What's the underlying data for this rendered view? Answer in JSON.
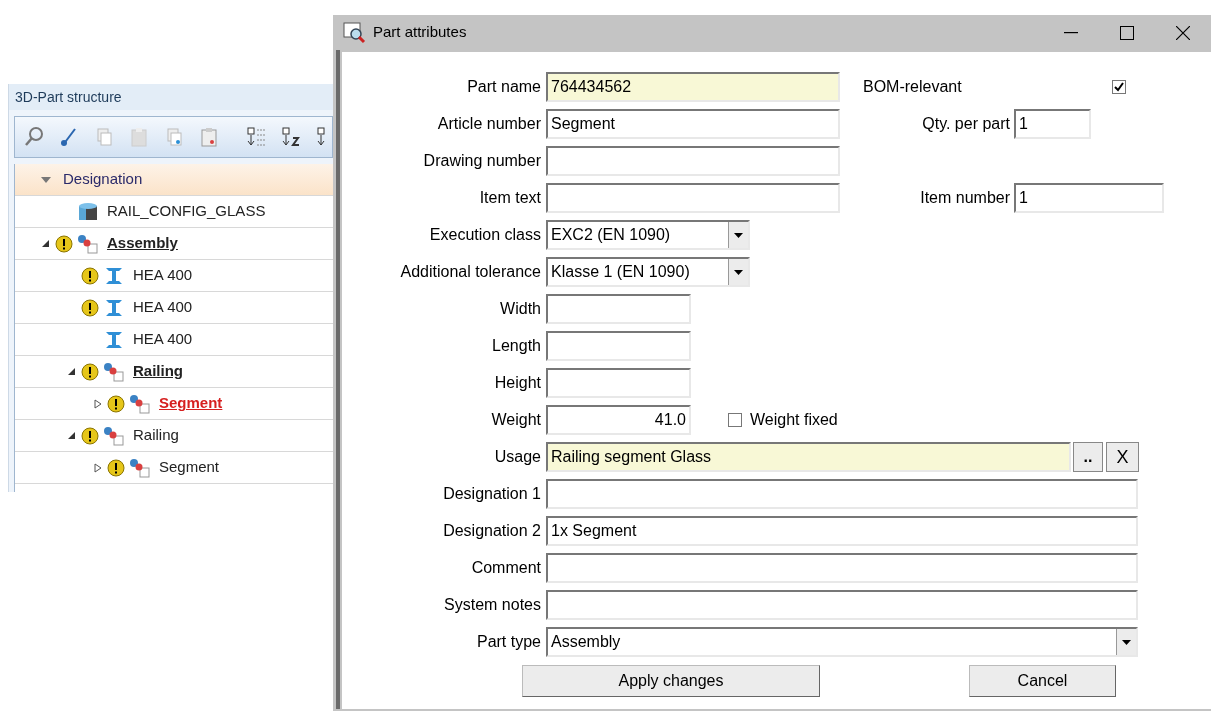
{
  "structure_panel": {
    "title": "3D-Part structure",
    "column_header": "Designation",
    "tree": [
      {
        "label": "RAIL_CONFIG_GLASS",
        "kind": "config",
        "warning": false,
        "underlined": false,
        "selected": false
      },
      {
        "label": "Assembly",
        "kind": "assembly",
        "warning": true,
        "underlined": true,
        "selected": false,
        "expanded": true,
        "children": [
          {
            "label": "HEA 400",
            "kind": "beam",
            "warning": true,
            "underlined": false,
            "selected": false
          },
          {
            "label": "HEA 400",
            "kind": "beam",
            "warning": true,
            "underlined": false,
            "selected": false
          },
          {
            "label": "HEA 400",
            "kind": "beam",
            "warning": false,
            "underlined": false,
            "selected": false
          },
          {
            "label": "Railing",
            "kind": "assembly",
            "warning": true,
            "underlined": true,
            "selected": false,
            "expanded": true,
            "children": [
              {
                "label": "Segment",
                "kind": "assembly",
                "warning": true,
                "underlined": true,
                "selected": true,
                "expanded": false
              }
            ]
          },
          {
            "label": "Railing",
            "kind": "assembly",
            "warning": true,
            "underlined": false,
            "selected": false,
            "expanded": true,
            "children": [
              {
                "label": "Segment",
                "kind": "assembly",
                "warning": true,
                "underlined": false,
                "selected": false,
                "expanded": false
              }
            ]
          }
        ]
      }
    ]
  },
  "dialog": {
    "title": "Part attributes",
    "rows": [
      {
        "label": "Part name",
        "kind": "text",
        "value": "764434562",
        "highlighted": true,
        "extra": {
          "kind": "flag",
          "label": "BOM-relevant",
          "checked": true
        }
      },
      {
        "label": "Article number",
        "kind": "text",
        "value": "Segment",
        "highlighted": false,
        "extra": {
          "kind": "short_field",
          "label": "Qty. per part",
          "value": "1"
        }
      },
      {
        "label": "Drawing number",
        "kind": "text",
        "value": "",
        "highlighted": false
      },
      {
        "label": "Item text",
        "kind": "text",
        "value": "",
        "highlighted": false,
        "extra": {
          "kind": "field",
          "label": "Item number",
          "value": "1"
        }
      },
      {
        "label": "Execution class",
        "kind": "select",
        "value": "EXC2 (EN 1090)",
        "highlighted": false
      },
      {
        "label": "Additional tolerance",
        "kind": "select",
        "value": "Klasse 1 (EN 1090)",
        "highlighted": false
      },
      {
        "label": "Width",
        "kind": "short",
        "value": "",
        "highlighted": false
      },
      {
        "label": "Length",
        "kind": "short",
        "value": "",
        "highlighted": false
      },
      {
        "label": "Height",
        "kind": "short",
        "value": "",
        "highlighted": false
      },
      {
        "label": "Weight",
        "kind": "number",
        "value": "41.0",
        "highlighted": false,
        "extra": {
          "kind": "checkbox",
          "label": "Weight fixed",
          "checked": false
        }
      },
      {
        "label": "Usage",
        "kind": "usage",
        "value": "Railing segment Glass",
        "highlighted": true,
        "browse": "..",
        "clear": "X"
      },
      {
        "label": "Designation 1",
        "kind": "wide",
        "value": "",
        "highlighted": false
      },
      {
        "label": "Designation 2",
        "kind": "wide",
        "value": "1x Segment",
        "highlighted": false
      },
      {
        "label": "Comment",
        "kind": "wide",
        "value": "",
        "highlighted": false
      },
      {
        "label": "System notes",
        "kind": "wide",
        "value": "",
        "highlighted": false
      },
      {
        "label": "Part type",
        "kind": "wide_select",
        "value": "Assembly",
        "highlighted": false
      }
    ],
    "buttons": [
      "Apply changes",
      "Cancel"
    ]
  }
}
